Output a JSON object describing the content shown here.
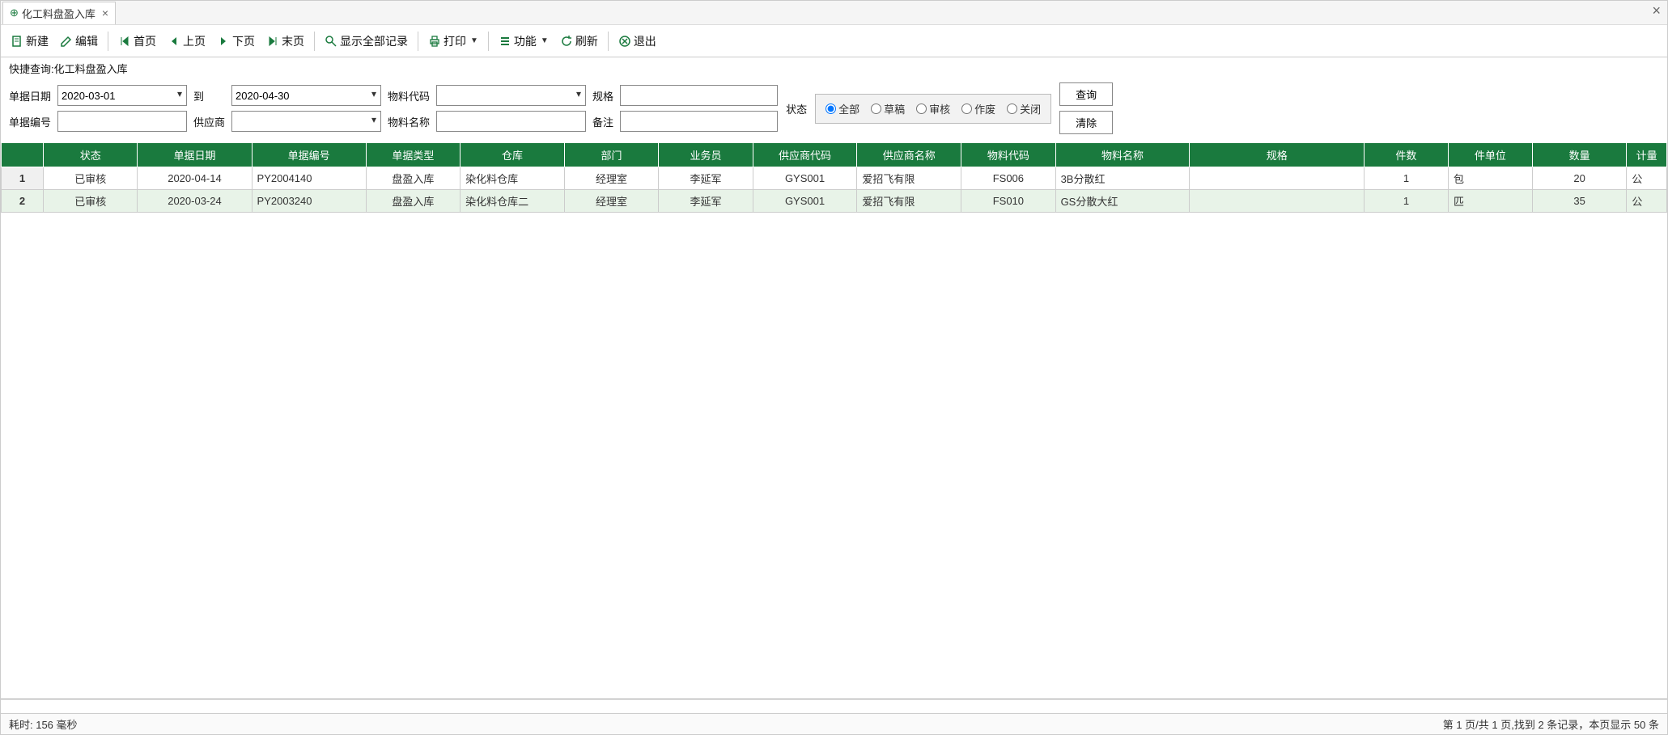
{
  "tab": {
    "title": "化工料盘盈入库"
  },
  "toolbar": {
    "new": "新建",
    "edit": "编辑",
    "first": "首页",
    "prev": "上页",
    "next": "下页",
    "last": "末页",
    "showall": "显示全部记录",
    "print": "打印",
    "func": "功能",
    "refresh": "刷新",
    "exit": "退出"
  },
  "query": {
    "title": "快捷查询:化工料盘盈入库",
    "labels": {
      "doc_date": "单据日期",
      "to": "到",
      "material_code": "物料代码",
      "spec": "规格",
      "doc_no": "单据编号",
      "supplier": "供应商",
      "material_name": "物料名称",
      "remark": "备注",
      "status": "状态"
    },
    "values": {
      "date_from": "2020-03-01",
      "date_to": "2020-04-30",
      "material_code": "",
      "spec": "",
      "doc_no": "",
      "supplier": "",
      "material_name": "",
      "remark": ""
    },
    "status_options": {
      "all": "全部",
      "draft": "草稿",
      "approved": "审核",
      "void": "作废",
      "closed": "关闭"
    },
    "status_selected": "all",
    "buttons": {
      "search": "查询",
      "clear": "清除"
    }
  },
  "table": {
    "headers": {
      "status": "状态",
      "doc_date": "单据日期",
      "doc_no": "单据编号",
      "doc_type": "单据类型",
      "warehouse": "仓库",
      "dept": "部门",
      "clerk": "业务员",
      "supplier_code": "供应商代码",
      "supplier_name": "供应商名称",
      "material_code": "物料代码",
      "material_name": "物料名称",
      "spec": "规格",
      "pieces": "件数",
      "piece_unit": "件单位",
      "qty": "数量",
      "unit": "计量"
    },
    "rows": [
      {
        "status": "已审核",
        "doc_date": "2020-04-14",
        "doc_no": "PY2004140",
        "doc_type": "盘盈入库",
        "warehouse": "染化料仓库",
        "dept": "经理室",
        "clerk": "李延军",
        "supplier_code": "GYS001",
        "supplier_name": "爱招飞有限",
        "material_code": "FS006",
        "material_name": "3B分散红",
        "spec": "",
        "pieces": "1",
        "piece_unit": "包",
        "qty": "20",
        "unit": "公"
      },
      {
        "status": "已审核",
        "doc_date": "2020-03-24",
        "doc_no": "PY2003240",
        "doc_type": "盘盈入库",
        "warehouse": "染化料仓库二",
        "dept": "经理室",
        "clerk": "李延军",
        "supplier_code": "GYS001",
        "supplier_name": "爱招飞有限",
        "material_code": "FS010",
        "material_name": "GS分散大红",
        "spec": "",
        "pieces": "1",
        "piece_unit": "匹",
        "qty": "35",
        "unit": "公"
      }
    ]
  },
  "statusbar": {
    "left": "耗时: 156 毫秒",
    "right": "第 1 页/共 1 页,找到 2 条记录，本页显示 50 条"
  }
}
